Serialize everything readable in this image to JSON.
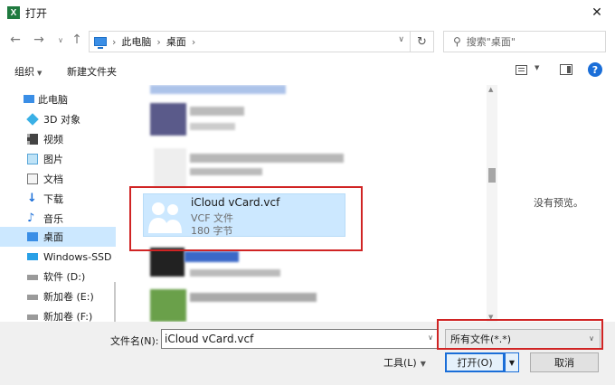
{
  "window": {
    "title": "打开",
    "app_icon_letter": "X"
  },
  "address": {
    "crumbs": [
      "此电脑",
      "桌面"
    ],
    "search_placeholder": "搜索\"桌面\""
  },
  "toolbar": {
    "organize": "组织",
    "new_folder": "新建文件夹"
  },
  "sidebar": {
    "items": [
      {
        "label": "此电脑",
        "icon": "pc-icon"
      },
      {
        "label": "3D 对象",
        "icon": "cube-icon"
      },
      {
        "label": "视频",
        "icon": "video-icon"
      },
      {
        "label": "图片",
        "icon": "picture-icon"
      },
      {
        "label": "文档",
        "icon": "document-icon"
      },
      {
        "label": "下载",
        "icon": "download-icon"
      },
      {
        "label": "音乐",
        "icon": "music-icon"
      },
      {
        "label": "桌面",
        "icon": "desktop-icon"
      },
      {
        "label": "Windows-SSD (",
        "icon": "drive-icon"
      },
      {
        "label": "软件 (D:)",
        "icon": "drive-icon"
      },
      {
        "label": "新加卷 (E:)",
        "icon": "drive-icon"
      },
      {
        "label": "新加卷 (F:)",
        "icon": "drive-icon"
      }
    ],
    "selected": "桌面"
  },
  "file": {
    "name": "iCloud vCard.vcf",
    "type": "VCF 文件",
    "size": "180 字节"
  },
  "preview": {
    "text": "没有预览。"
  },
  "bottom": {
    "filename_label": "文件名(N):",
    "filename_value": "iCloud vCard.vcf",
    "filetype_value": "所有文件(*.*)",
    "tools_label": "工具(L)",
    "open_label": "打开(O)",
    "cancel_label": "取消"
  },
  "colors": {
    "selection": "#cce8ff",
    "annotation": "#d02424",
    "accent": "#1a6ed8"
  }
}
